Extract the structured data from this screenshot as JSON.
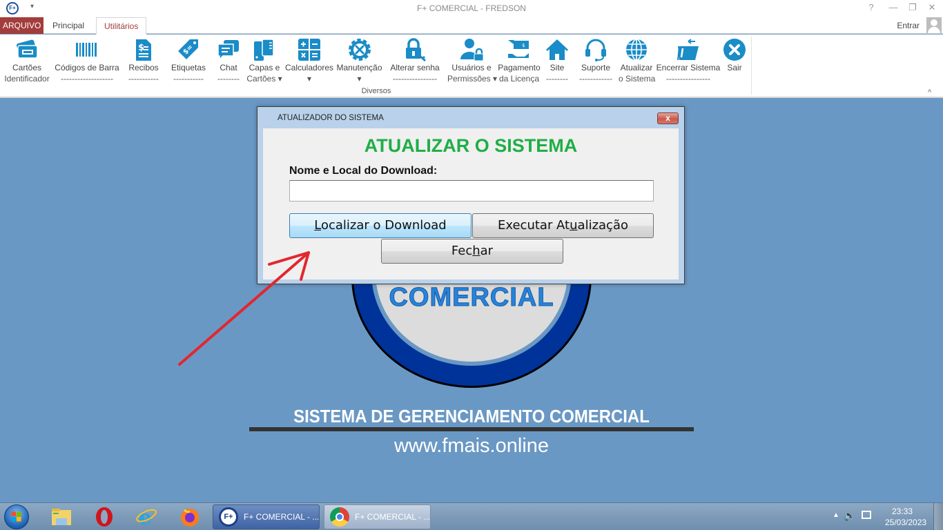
{
  "window": {
    "title": "F+ COMERCIAL - FREDSON",
    "app_logo": "F+",
    "controls": {
      "help": "?",
      "minimize": "—",
      "restore": "❐",
      "close": "✕"
    }
  },
  "tabs": [
    {
      "label": "ARQUIVO"
    },
    {
      "label": "Principal"
    },
    {
      "label": "Utilitários",
      "active": true
    }
  ],
  "account": {
    "signin_label": "Entrar"
  },
  "ribbon": {
    "group_label": "Diversos",
    "buttons": [
      {
        "line1": "Cartões",
        "line2": "Identificador",
        "icon": "id-card-icon"
      },
      {
        "line1": "Códigos de Barra",
        "line2": "-------------------",
        "icon": "barcode-icon"
      },
      {
        "line1": "Recibos",
        "line2": "-----------",
        "icon": "receipt-icon"
      },
      {
        "line1": "Etiquetas",
        "line2": "-----------",
        "icon": "price-tag-icon"
      },
      {
        "line1": "Chat",
        "line2": "--------",
        "icon": "chat-icon"
      },
      {
        "line1": "Capas e",
        "line2": "Cartões ▾",
        "icon": "card-covers-icon"
      },
      {
        "line1": "Calculadores",
        "line2": "▾",
        "icon": "calculator-icon"
      },
      {
        "line1": "Manutenção",
        "line2": "▾",
        "icon": "maintenance-gear-icon"
      },
      {
        "line1": "Alterar senha",
        "line2": "----------------",
        "icon": "lock-key-icon"
      },
      {
        "line1": "Usuários e",
        "line2": "Permissões ▾",
        "icon": "user-lock-icon"
      },
      {
        "line1": "Pagamento",
        "line2": "da Licença",
        "icon": "payment-hand-icon"
      },
      {
        "line1": "Site",
        "line2": "--------",
        "icon": "home-icon"
      },
      {
        "line1": "Suporte",
        "line2": "------------",
        "icon": "headset-icon"
      },
      {
        "line1": "Atualizar",
        "line2": "o Sistema",
        "icon": "globe-icon"
      },
      {
        "line1": "Encerrar Sistema",
        "line2": "----------------",
        "icon": "folder-exit-icon"
      },
      {
        "line1": "Sair",
        "line2": "",
        "icon": "close-circle-icon"
      }
    ],
    "collapse_glyph": "^"
  },
  "dialog": {
    "title": "ATUALIZADOR DO SISTEMA",
    "close_glyph": "x",
    "heading": "ATUALIZAR O SISTEMA",
    "field_label": "Nome e Local do Download:",
    "field_value": "",
    "buttons": {
      "localizar": {
        "pre": "",
        "accel": "L",
        "post": "ocalizar o Download"
      },
      "executar": {
        "pre": "Executar At",
        "accel": "u",
        "post": "alização"
      },
      "fechar": {
        "pre": "Fec",
        "accel": "h",
        "post": "ar"
      }
    }
  },
  "background": {
    "logo_text": "COMERCIAL",
    "tagline": "SISTEMA DE GERENCIAMENTO COMERCIAL",
    "url": "www.fmais.online"
  },
  "annotation": {
    "type": "red-arrow",
    "points_to": "Localizar o Download",
    "color": "#e3262e"
  },
  "taskbar": {
    "pinned": [
      "start-orb",
      "file-explorer",
      "opera",
      "internet-explorer",
      "firefox"
    ],
    "tasks": [
      {
        "label": "F+ COMERCIAL - ...",
        "app": "fplus",
        "active": true
      },
      {
        "label": "F+ COMERCIAL - ...",
        "app": "chrome",
        "active": false
      }
    ],
    "clock": {
      "time": "23:33",
      "date": "25/03/2023"
    }
  },
  "colors": {
    "accent_red": "#a33c3c",
    "desktop_blue": "#6a98c4",
    "ribbon_icon_blue": "#1a8cc7",
    "heading_green": "#1fae46"
  }
}
